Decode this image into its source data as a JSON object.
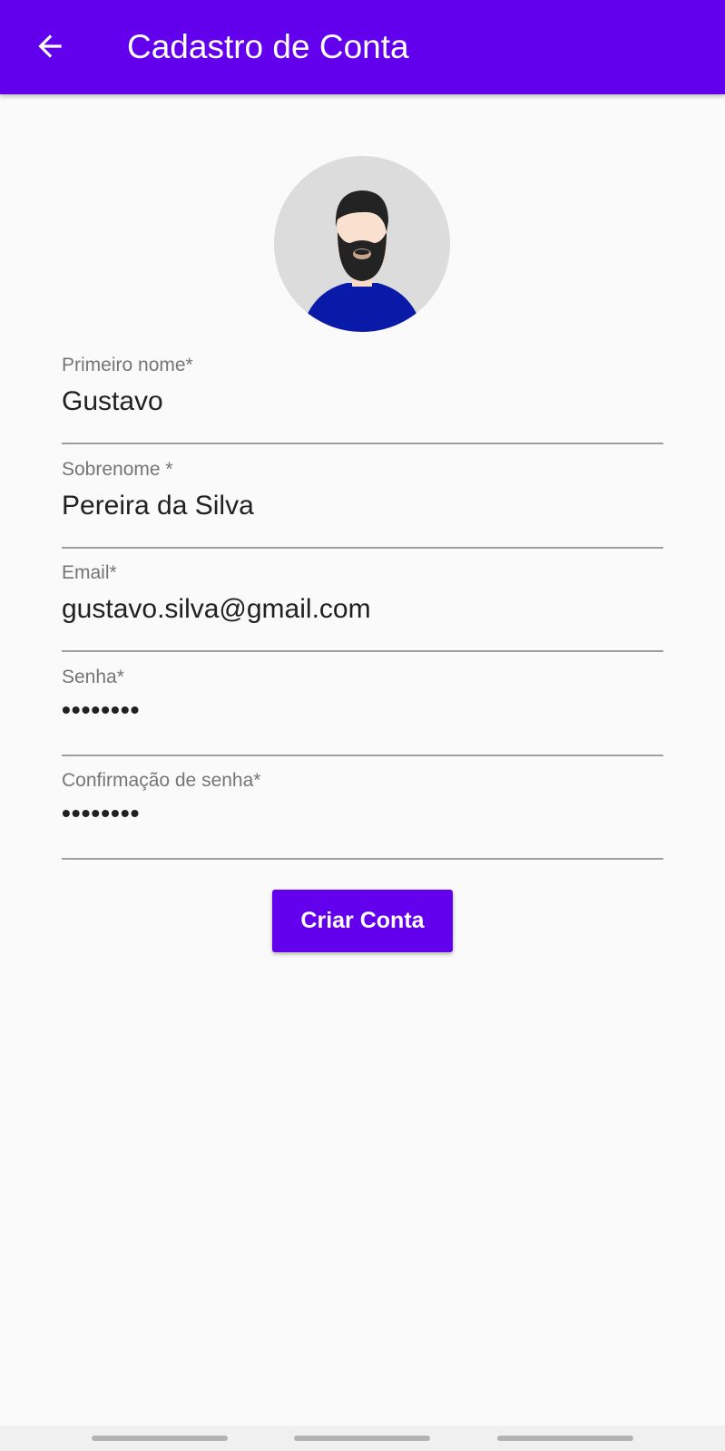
{
  "app_bar": {
    "title": "Cadastro de Conta",
    "back_icon": "arrow-back-icon",
    "background_color": "#6200ee"
  },
  "avatar": {
    "icon": "bearded-man-avatar-icon"
  },
  "form": {
    "fields": [
      {
        "label": "Primeiro nome*",
        "value": "Gustavo"
      },
      {
        "label": "Sobrenome *",
        "value": "Pereira da Silva"
      },
      {
        "label": "Email*",
        "value": "gustavo.silva@gmail.com"
      },
      {
        "label": "Senha*",
        "value": "••••••••"
      },
      {
        "label": "Confirmação de senha*",
        "value": "••••••••"
      }
    ],
    "submit_label": "Criar Conta"
  }
}
